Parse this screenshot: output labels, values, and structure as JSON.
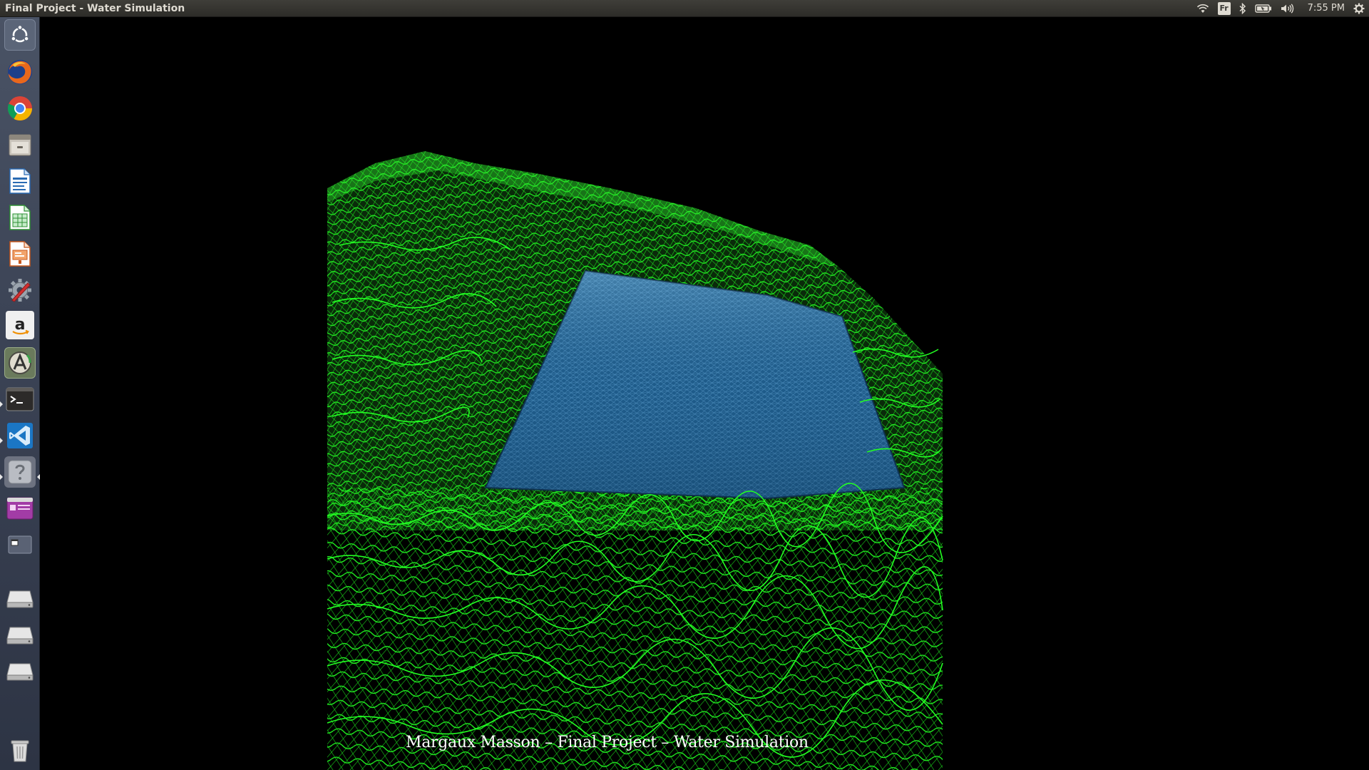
{
  "window": {
    "title": "Final Project - Water Simulation"
  },
  "panel": {
    "keyboard_layout": "Fr",
    "clock": "7:55 PM",
    "indicators": [
      "wifi-icon",
      "keyboard-layout-indicator",
      "bluetooth-icon",
      "battery-icon",
      "volume-icon",
      "gear-icon"
    ]
  },
  "launcher": {
    "items": [
      {
        "name": "dash-home",
        "icon": "ubuntu-logo-icon"
      },
      {
        "name": "firefox",
        "icon": "firefox-icon"
      },
      {
        "name": "chrome",
        "icon": "chrome-icon"
      },
      {
        "name": "files",
        "icon": "file-cabinet-icon"
      },
      {
        "name": "writer",
        "icon": "libreoffice-writer-icon"
      },
      {
        "name": "calc",
        "icon": "libreoffice-calc-icon"
      },
      {
        "name": "impress",
        "icon": "libreoffice-impress-icon"
      },
      {
        "name": "system-settings",
        "icon": "wrench-gear-icon"
      },
      {
        "name": "amazon",
        "icon": "amazon-icon"
      },
      {
        "name": "software-updater",
        "icon": "software-updater-icon"
      },
      {
        "name": "terminal",
        "icon": "terminal-icon"
      },
      {
        "name": "vscode",
        "icon": "vscode-icon"
      },
      {
        "name": "help",
        "icon": "question-mark-icon"
      },
      {
        "name": "workspace-switcher",
        "icon": "workspace-icon"
      },
      {
        "name": "window",
        "icon": "window-icon"
      },
      {
        "name": "drive-1",
        "icon": "hard-drive-icon"
      },
      {
        "name": "drive-2",
        "icon": "hard-drive-icon"
      },
      {
        "name": "drive-3",
        "icon": "hard-drive-icon"
      },
      {
        "name": "trash",
        "icon": "trash-icon"
      }
    ],
    "colors": {
      "background": "#3c4456"
    }
  },
  "scene": {
    "caption": "Margaux Masson – Final Project – Water Simulation",
    "terrain_color": "#22ff22",
    "water_color": "#1d5a88",
    "background": "#000000"
  }
}
